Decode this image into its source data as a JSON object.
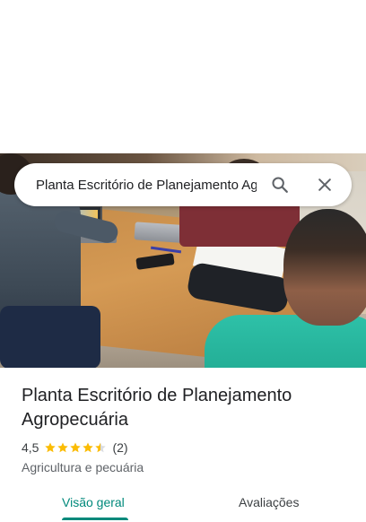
{
  "search": {
    "query": "Planta Escritório de Planejamento Agropecuária",
    "search_icon": "search-icon",
    "close_icon": "close-icon"
  },
  "hero": {
    "alt": "office-meeting-photo"
  },
  "place": {
    "name": "Planta Escritório de Planejamento Agropecuária",
    "rating": "4,5",
    "rating_value": 4.5,
    "rating_max": 5,
    "review_count": "(2)",
    "category": "Agricultura e pecuária"
  },
  "tabs": [
    {
      "label": "Visão geral",
      "active": true
    },
    {
      "label": "Avaliações",
      "active": false
    }
  ],
  "colors": {
    "accent": "#00897b",
    "star": "#fbbc04",
    "text_primary": "#202124",
    "text_secondary": "#5f6368"
  }
}
